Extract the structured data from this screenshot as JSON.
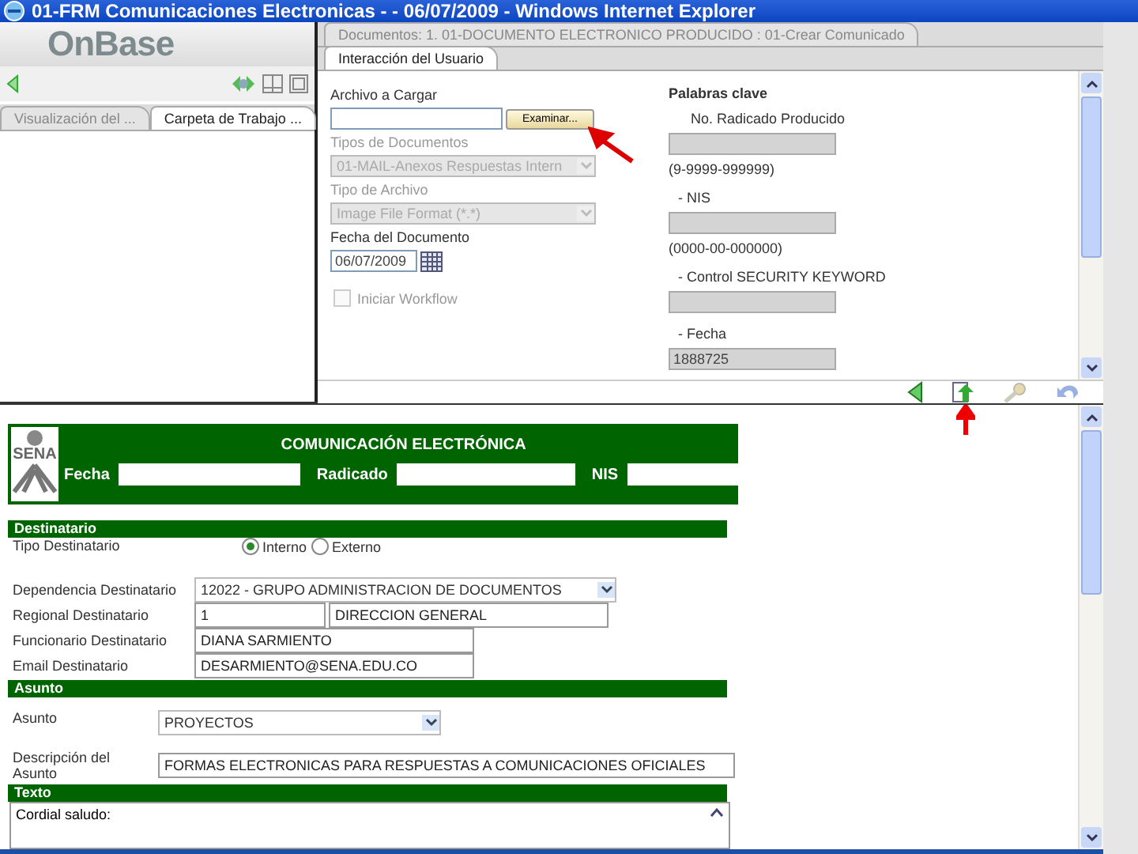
{
  "window": {
    "title": "01-FRM Comunicaciones Electronicas - - 06/07/2009 - Windows Internet Explorer"
  },
  "left_pane": {
    "logo": "OnBase",
    "tabs": [
      {
        "label": "Visualización del ...",
        "selected": false
      },
      {
        "label": "Carpeta de Trabajo ...",
        "selected": true
      }
    ]
  },
  "document_tabs": [
    {
      "label": "Documentos: 1. 01-DOCUMENTO ELECTRONICO PRODUCIDO : 01-Crear Comunicado",
      "selected": false
    },
    {
      "label": "Interacción del Usuario",
      "selected": true
    }
  ],
  "upload": {
    "label": "Archivo a Cargar",
    "button": "Examinar..."
  },
  "fields": [
    {
      "kind": "select",
      "label": "Tipos de Documentos",
      "value": "01-MAIL-Anexos Respuestas Intern",
      "disabled": true
    },
    {
      "kind": "select",
      "label": "Tipo de Archivo",
      "value": "Image File Format (*.*)",
      "disabled": true
    },
    {
      "kind": "date",
      "label": "Fecha del Documento",
      "value": "06/07/2009",
      "disabled": false
    },
    {
      "kind": "checkbox",
      "label": "Iniciar Workflow",
      "checked": false,
      "disabled": true
    }
  ],
  "keywords": {
    "title": "Palabras clave",
    "items": [
      {
        "label": "No. Radicado Producido",
        "hint": "(9-9999-999999)"
      },
      {
        "label": "- NIS",
        "hint": "(0000-00-000000)"
      },
      {
        "label": "- Control SECURITY KEYWORD"
      },
      {
        "label": "- Fecha",
        "value": "1888725"
      }
    ]
  },
  "form": {
    "logo": "SENA",
    "title": "COMUNICACIÓN ELECTRÓNICA",
    "header_fields": [
      {
        "label": "Fecha"
      },
      {
        "label": "Radicado"
      },
      {
        "label": "NIS"
      }
    ],
    "sections": [
      {
        "title": "Destinatario",
        "rows": [
          {
            "kind": "radio",
            "label": "Tipo Destinatario",
            "options": [
              {
                "label": "Interno",
                "selected": true
              },
              {
                "label": "Externo",
                "selected": false
              }
            ]
          },
          {
            "kind": "select",
            "label": "Dependencia Destinatario",
            "value": "12022 - GRUPO ADMINISTRACION DE DOCUMENTOS"
          },
          {
            "kind": "pair",
            "label": "Regional Destinatario",
            "values": [
              "1",
              "DIRECCION GENERAL"
            ]
          },
          {
            "kind": "text",
            "label": "Funcionario Destinatario",
            "value": "DIANA SARMIENTO"
          },
          {
            "kind": "text",
            "label": "Email Destinatario",
            "value": "DESARMIENTO@SENA.EDU.CO"
          }
        ]
      },
      {
        "title": "Asunto",
        "rows": [
          {
            "kind": "select",
            "label": "Asunto",
            "value": "PROYECTOS"
          },
          {
            "kind": "wide",
            "label": "Descripción del Asunto",
            "value": "FORMAS ELECTRONICAS PARA RESPUESTAS A COMUNICACIONES OFICIALES"
          }
        ]
      },
      {
        "title": "Texto",
        "rows": [
          {
            "kind": "textarea",
            "value": "Cordial saludo:"
          }
        ]
      }
    ]
  }
}
